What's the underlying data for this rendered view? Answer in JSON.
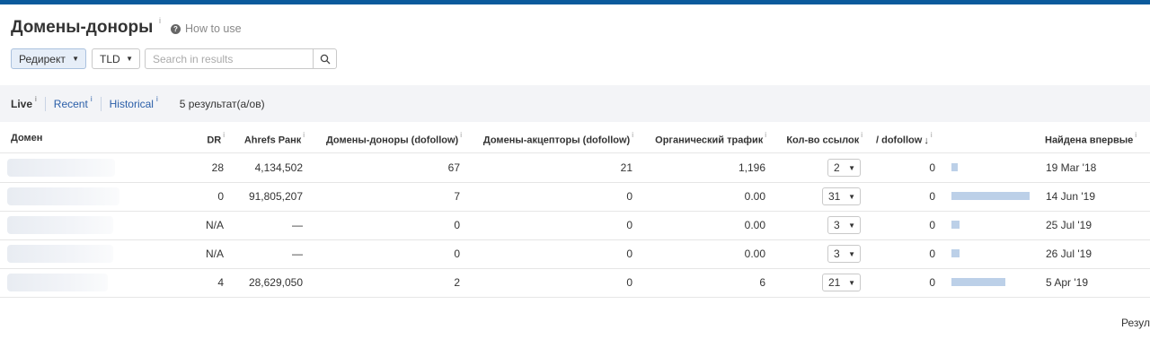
{
  "header": {
    "title": "Домены-доноры",
    "title_info": "i",
    "help_icon_glyph": "?",
    "how_to_use": "How to use"
  },
  "controls": {
    "redirect_label": "Редирект",
    "tld_label": "TLD",
    "search_placeholder": "Search in results"
  },
  "tabs": {
    "live": "Live",
    "recent": "Recent",
    "historical": "Historical",
    "info": "i",
    "results_count": "5 результат(а/ов)"
  },
  "table": {
    "columns": {
      "domain": "Домен",
      "dr": "DR",
      "ahrefs_rank": "Ahrefs Ранк",
      "ref_domains": "Домены-доноры (dofollow)",
      "linked_domains": "Домены-акцепторы (dofollow)",
      "traffic": "Органический трафик",
      "links": "Кол-во ссылок",
      "dofollow": "/ dofollow",
      "first_seen": "Найдена впервые",
      "info": "i"
    },
    "rows": [
      {
        "dr": "28",
        "rank": "4,134,502",
        "ref": "67",
        "linked": "21",
        "traffic": "1,196",
        "links": "2",
        "dofollow": "0",
        "bar_ratio": 0.08,
        "first_seen": "19 Mar '18"
      },
      {
        "dr": "0",
        "rank": "91,805,207",
        "ref": "7",
        "linked": "0",
        "traffic": "0.00",
        "links": "31",
        "dofollow": "0",
        "bar_ratio": 1.0,
        "first_seen": "14 Jun '19"
      },
      {
        "dr": "N/A",
        "rank": "—",
        "ref": "0",
        "linked": "0",
        "traffic": "0.00",
        "links": "3",
        "dofollow": "0",
        "bar_ratio": 0.1,
        "first_seen": "25 Jul '19"
      },
      {
        "dr": "N/A",
        "rank": "—",
        "ref": "0",
        "linked": "0",
        "traffic": "0.00",
        "links": "3",
        "dofollow": "0",
        "bar_ratio": 0.1,
        "first_seen": "26 Jul '19"
      },
      {
        "dr": "4",
        "rank": "28,629,050",
        "ref": "2",
        "linked": "0",
        "traffic": "6",
        "links": "21",
        "dofollow": "0",
        "bar_ratio": 0.69,
        "first_seen": "5 Apr '19"
      }
    ]
  },
  "footer": {
    "text": "Резул"
  },
  "colors": {
    "accent": "#0b5a9c",
    "link": "#2a5ea8",
    "bar": "#bcd0e8",
    "tabbar_bg": "#f3f4f7"
  },
  "icons": {
    "help": "question-circle-icon",
    "search": "magnifier-icon",
    "caret": "caret-down-icon",
    "sort": "sort-down-arrow-icon"
  }
}
